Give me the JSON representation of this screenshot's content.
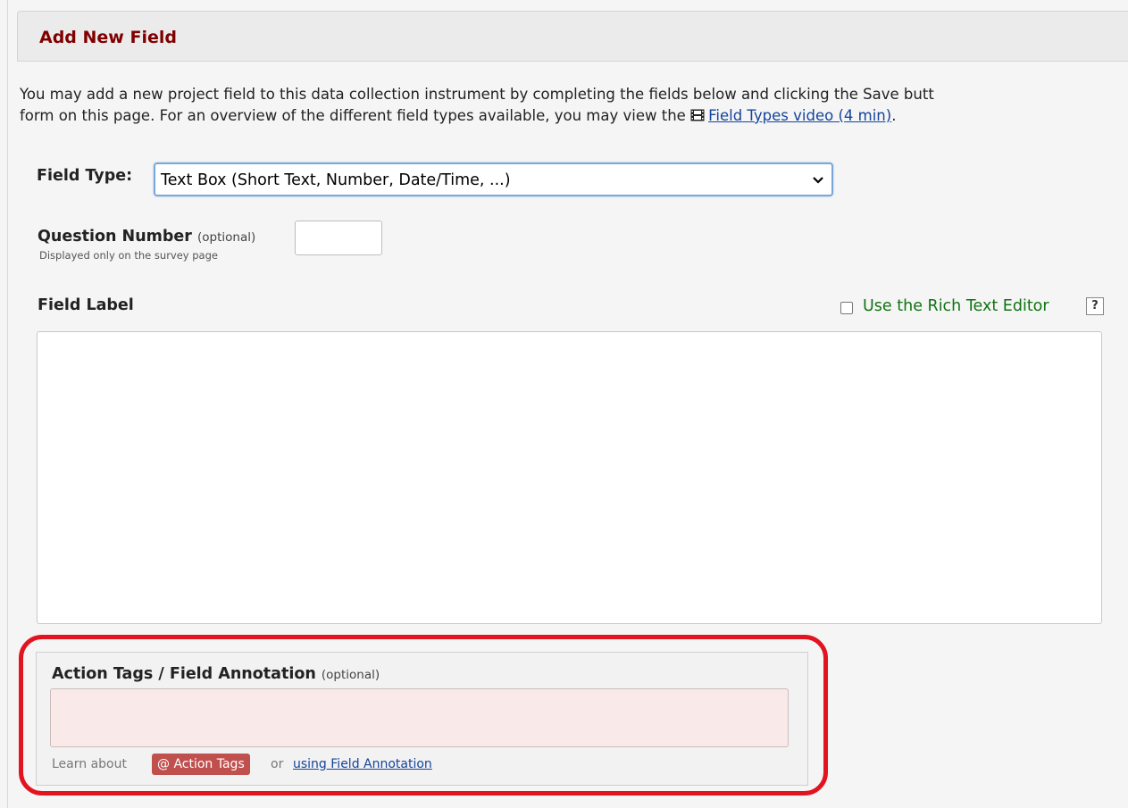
{
  "dialog": {
    "title": "Add New Field"
  },
  "intro": {
    "line1": "You may add a new project field to this data collection instrument by completing the fields below and clicking the Save butt",
    "line2_prefix": "form on this page. For an overview of the different field types available, you may view the ",
    "video_link": "Field Types video (4 min)",
    "line2_suffix": "."
  },
  "field_type": {
    "label": "Field Type:",
    "selected": "Text Box (Short Text, Number, Date/Time, ...)"
  },
  "question_number": {
    "label": "Question Number",
    "optional": "(optional)",
    "sublabel": "Displayed only on the survey page",
    "value": ""
  },
  "field_label": {
    "label": "Field Label",
    "rich_text_label": "Use the Rich Text Editor",
    "help": "?",
    "value": ""
  },
  "action_tags": {
    "label": "Action Tags / Field Annotation",
    "optional": "(optional)",
    "value": "",
    "learn_about": "Learn about",
    "badge": "@ Action Tags",
    "or": "or",
    "link": "using Field Annotation"
  },
  "colors": {
    "title": "#800000",
    "link": "#15449b",
    "rich_text": "#107312",
    "badge": "#c0504d",
    "highlight": "#e1141f"
  }
}
